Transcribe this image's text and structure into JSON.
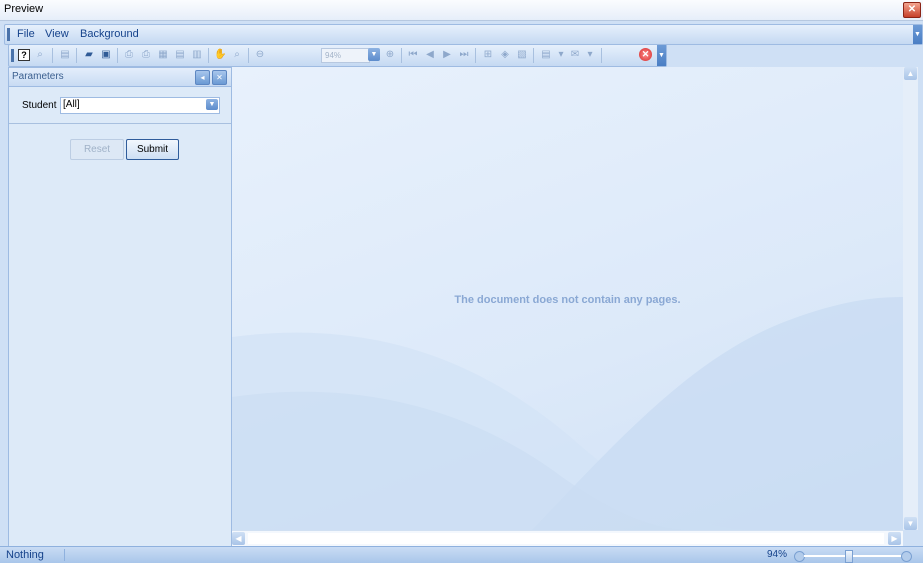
{
  "window": {
    "title": "Preview",
    "close_glyph": "✕"
  },
  "menu": {
    "items": [
      {
        "label": "File"
      },
      {
        "label": "View"
      },
      {
        "label": "Background"
      }
    ]
  },
  "toolbar": {
    "zoom_value": "94%",
    "icons": [
      "help-icon",
      "search-icon",
      "customize-icon",
      "open-icon",
      "save-icon",
      "print-icon",
      "quick-print-icon",
      "page-setup-icon",
      "header-footer-icon",
      "scale-icon",
      "hand-tool-icon",
      "magnifier-icon",
      "zoom-out-icon",
      "zoom-in-icon",
      "first-page-icon",
      "previous-page-icon",
      "next-page-icon",
      "last-page-icon",
      "multiple-pages-icon",
      "background-color-icon",
      "watermark-icon",
      "export-icon",
      "send-email-icon",
      "stop-icon"
    ]
  },
  "parameters": {
    "panel_title": "Parameters",
    "fields": [
      {
        "label": "Student",
        "value": "[All]"
      }
    ],
    "reset_label": "Reset",
    "submit_label": "Submit"
  },
  "document": {
    "empty_message": "The document does not contain any pages."
  },
  "status": {
    "text": "Nothing",
    "zoom": "94%"
  },
  "colors": {
    "accent": "#15428b",
    "panel_bg": "#ddeaf8",
    "doc_bg": "#e8f1fc"
  }
}
